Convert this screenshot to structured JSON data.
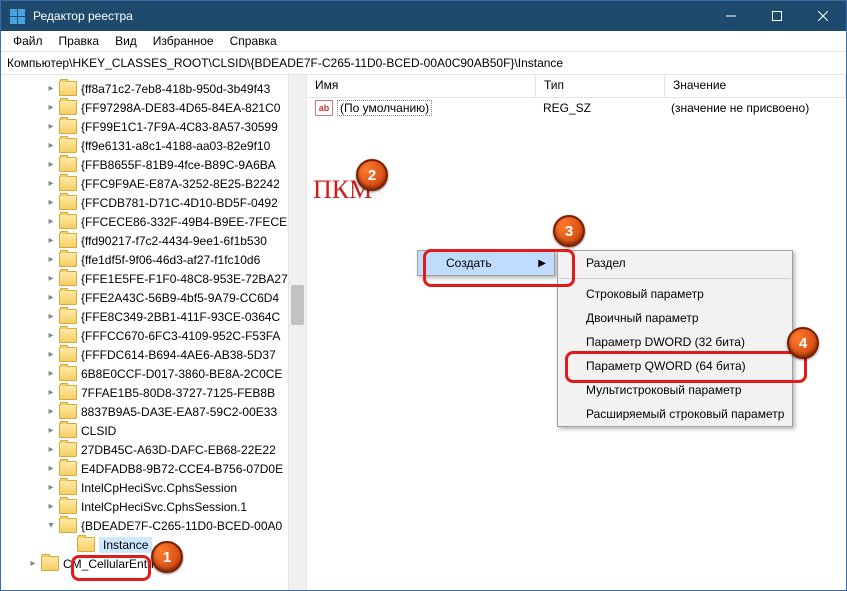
{
  "window": {
    "title": "Редактор реестра"
  },
  "menubar": [
    "Файл",
    "Правка",
    "Вид",
    "Избранное",
    "Справка"
  ],
  "addressbar": "Компьютер\\HKEY_CLASSES_ROOT\\CLSID\\{BDEADE7F-C265-11D0-BCED-00A0C90AB50F}\\Instance",
  "tree": {
    "items": [
      "{ff8a71c2-7eb8-418b-950d-3b49f43",
      "{FF97298A-DE83-4D65-84EA-821C0",
      "{FF99E1C1-7F9A-4C83-8A57-30599",
      "{ff9e6131-a8c1-4188-aa03-82e9f10",
      "{FFB8655F-81B9-4fce-B89C-9A6BA",
      "{FFC9F9AE-E87A-3252-8E25-B2242",
      "{FFCDB781-D71C-4D10-BD5F-0492",
      "{FFCECE86-332F-49B4-B9EE-7FECE",
      "{ffd90217-f7c2-4434-9ee1-6f1b530",
      "{ffe1df5f-9f06-46d3-af27-f1fc10d6",
      "{FFE1E5FE-F1F0-48C8-953E-72BA27",
      "{FFE2A43C-56B9-4bf5-9A79-CC6D4",
      "{FFE8C349-2BB1-411F-93CE-0364C",
      "{FFFCC670-6FC3-4109-952C-F53FA",
      "{FFFDC614-B694-4AE6-AB38-5D37",
      "6B8E0CCF-D017-3860-BE8A-2C0CE",
      "7FFAE1B5-80D8-3727-7125-FEB8B",
      "8837B9A5-DA3E-EA87-59C2-00E33",
      "CLSID",
      "27DB45C-A63D-DAFC-EB68-22E22",
      "E4DFADB8-9B72-CCE4-B756-07D0E",
      "IntelCpHeciSvc.CphsSession",
      "IntelCpHeciSvc.CphsSession.1"
    ],
    "current_parent": "{BDEADE7F-C265-11D0-BCED-00A0",
    "selected": "Instance",
    "sibling": "CM_CellularEntries"
  },
  "list": {
    "headers": {
      "name": "Имя",
      "type": "Тип",
      "value": "Значение"
    },
    "rows": [
      {
        "name": "(По умолчанию)",
        "type": "REG_SZ",
        "value": "(значение не присвоено)"
      }
    ]
  },
  "context": {
    "create": "Создать",
    "sub": [
      "Раздел",
      "Строковый параметр",
      "Двоичный параметр",
      "Параметр DWORD (32 бита)",
      "Параметр QWORD (64 бита)",
      "Мультистроковый параметр",
      "Расширяемый строковый параметр"
    ]
  },
  "annotations": {
    "pkm": "ПКМ",
    "b1": "1",
    "b2": "2",
    "b3": "3",
    "b4": "4"
  }
}
